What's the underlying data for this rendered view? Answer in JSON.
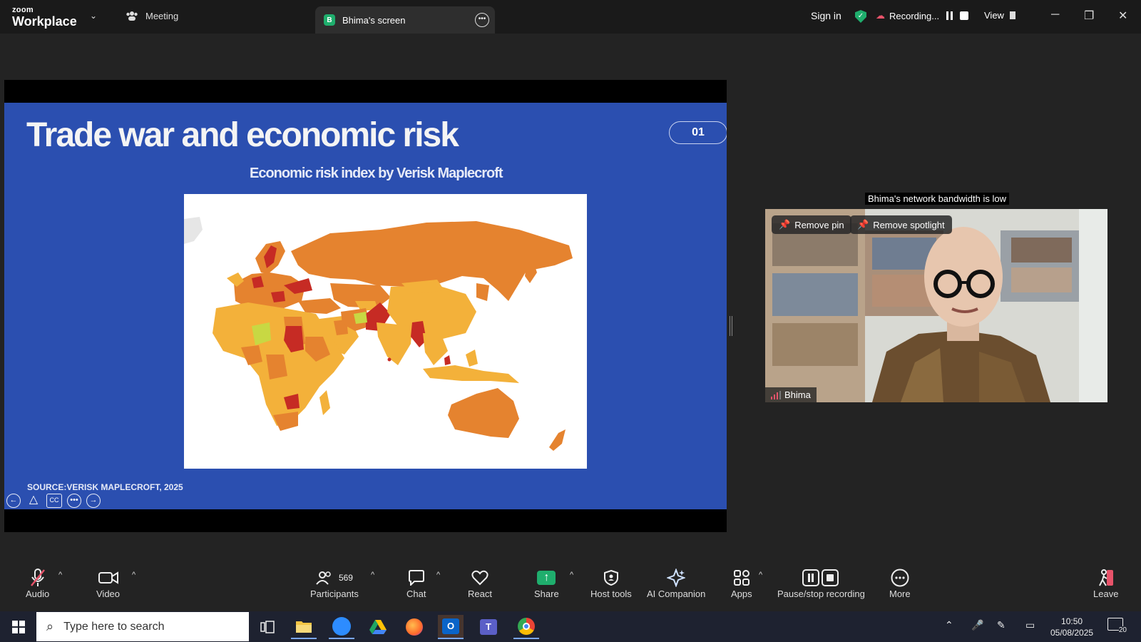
{
  "app": {
    "brand_top": "zoom",
    "brand_bottom": "Workplace"
  },
  "tabs": {
    "meeting": "Meeting",
    "screen": "Bhima's screen",
    "screen_badge": "B"
  },
  "header": {
    "sign_in": "Sign in",
    "recording": "Recording...",
    "view": "View"
  },
  "slide": {
    "title": "Trade war and economic risk",
    "number": "01",
    "subtitle": "Economic risk index by Verisk Maplecroft",
    "source": "SOURCE:VERISK MAPLECROFT, 2025",
    "cc_label": "CC"
  },
  "video": {
    "bandwidth_note": "Bhima's network bandwidth is low",
    "remove_pin": "Remove pin",
    "remove_spotlight": "Remove spotlight",
    "participant_name": "Bhima"
  },
  "toolbar": {
    "audio": "Audio",
    "video": "Video",
    "participants": "Participants",
    "participants_count": "569",
    "chat": "Chat",
    "react": "React",
    "share": "Share",
    "host_tools": "Host tools",
    "ai_companion": "AI Companion",
    "apps": "Apps",
    "pause_stop_recording": "Pause/stop recording",
    "more": "More",
    "leave": "Leave"
  },
  "taskbar": {
    "search_placeholder": "Type here to search",
    "time": "10:50",
    "date": "05/08/2025",
    "notifications": "20"
  },
  "colors": {
    "slide_bg": "#2b4fb0",
    "risk_high": "#c62b24",
    "risk_elevated": "#e5832f",
    "risk_medium": "#f3b13a",
    "risk_low": "#c8d843",
    "share_green": "#1fae6d",
    "recording_red": "#e8536a"
  }
}
